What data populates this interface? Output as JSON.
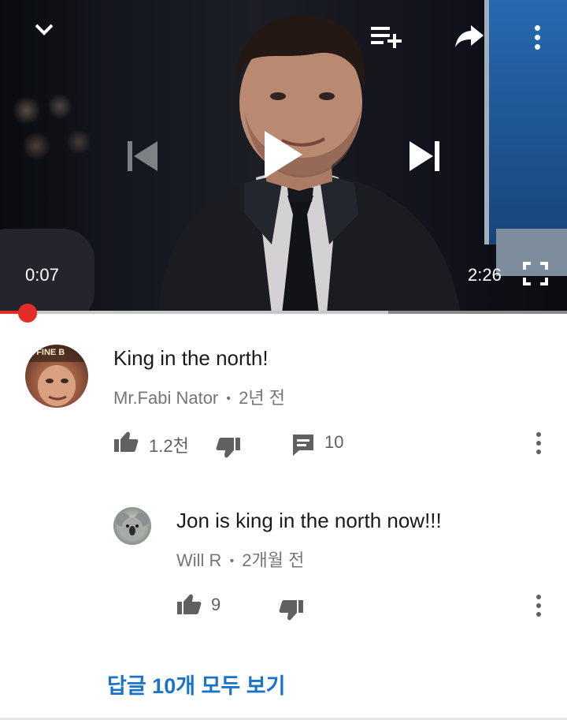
{
  "player": {
    "current_time": "0:07",
    "duration": "2:26",
    "progress_fraction": 0.049,
    "buffered_fraction": 0.685,
    "icons": {
      "collapse": "chevron-down-icon",
      "add_to_playlist": "playlist-add-icon",
      "share": "share-icon",
      "more": "more-vert-icon",
      "previous": "skip-previous-icon",
      "play": "play-icon",
      "next": "skip-next-icon",
      "fullscreen": "fullscreen-icon"
    },
    "accent_color": "#e52d27"
  },
  "comment": {
    "text": "King in the north!",
    "author": "Mr.Fabi Nator",
    "separator": "•",
    "time": "2년 전",
    "likes": "1.2천",
    "replies": "10",
    "avatar_text": "Y FINE B"
  },
  "reply": {
    "text": "Jon is king in the north now!!!",
    "author": "Will R",
    "separator": "•",
    "time": "2개월 전",
    "likes": "9"
  },
  "view_replies_label": "답글 10개 모두 보기",
  "link_color": "#1a73c8"
}
